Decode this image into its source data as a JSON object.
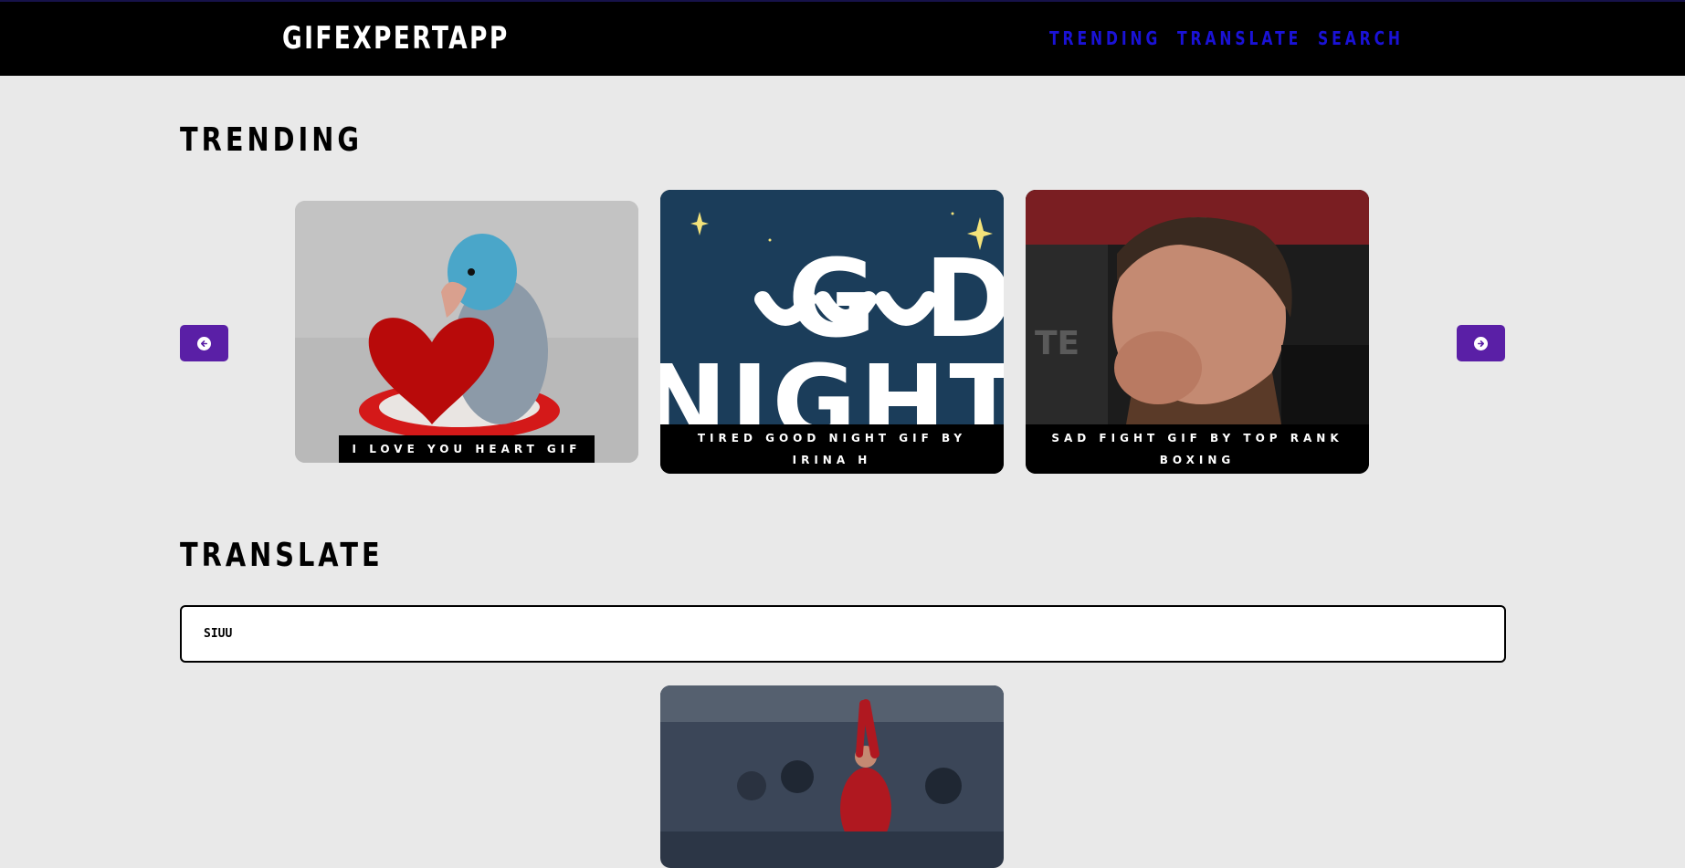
{
  "app": {
    "title": "GIFEXPERTAPP"
  },
  "nav": {
    "items": [
      "TRENDING",
      "TRANSLATE",
      "SEARCH"
    ]
  },
  "colors": {
    "background": "#e9e9e9",
    "header": "#000000",
    "nav_link": "#1a12d6",
    "arrow_button": "#5a1fa6"
  },
  "trending": {
    "title": "TRENDING",
    "prev_icon": "arrow-left-icon",
    "next_icon": "arrow-right-icon",
    "cards": [
      {
        "caption": "I LOVE YOU HEART GIF"
      },
      {
        "caption": "TIRED GOOD NIGHT GIF BY IRINA H",
        "image_text": "GUUD NIGHT"
      },
      {
        "caption": "SAD FIGHT GIF BY TOP RANK BOXING"
      }
    ]
  },
  "translate": {
    "title": "TRANSLATE",
    "input_value": "SIUU"
  }
}
